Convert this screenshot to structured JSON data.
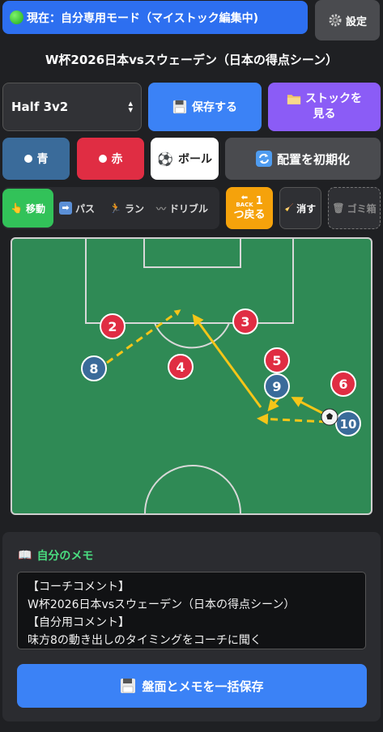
{
  "header": {
    "mode_label": "現在：自分専用モード（マイストック編集中)",
    "settings_label": "設定"
  },
  "match_title": "W杯2026日本vsスウェーデン（日本の得点シーン）",
  "controls": {
    "formation_value": "Half 3v2",
    "save_label": "保存する",
    "stock_label_line1": "ストックを",
    "stock_label_line2": "見る",
    "blue_label": "青",
    "red_label": "赤",
    "ball_label": "ボール",
    "reset_label": "配置を初期化"
  },
  "tools": {
    "move_label": "移動",
    "pass_label": "パス",
    "run_label": "ラン",
    "dribble_label": "ドリブル",
    "undo_count": "1",
    "undo_back": "BACK",
    "undo_label": "つ戻る",
    "erase_label": "消す",
    "trash_label": "ゴミ箱"
  },
  "colors": {
    "blue_team": "#3a6b9a",
    "red_team": "#e02d43",
    "pitch": "#2f8a55",
    "arrow": "#f5c518",
    "accent": "#3b82f6"
  },
  "players": [
    {
      "team": "red",
      "number": "2"
    },
    {
      "team": "red",
      "number": "3"
    },
    {
      "team": "red",
      "number": "4"
    },
    {
      "team": "red",
      "number": "5"
    },
    {
      "team": "red",
      "number": "6"
    },
    {
      "team": "blue",
      "number": "8"
    },
    {
      "team": "blue",
      "number": "9"
    },
    {
      "team": "blue",
      "number": "10"
    }
  ],
  "memo": {
    "heading": "自分のメモ",
    "lines": [
      "【コーチコメント】",
      "W杯2026日本vsスウェーデン（日本の得点シーン）",
      "【自分用コメント】",
      "味方8の動き出しのタイミングをコーチに聞く"
    ],
    "bulk_save_label": "盤面とメモを一括保存"
  }
}
